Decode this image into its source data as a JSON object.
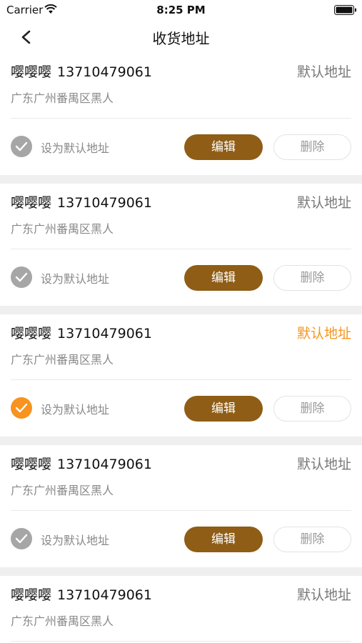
{
  "status_bar": {
    "carrier": "Carrier",
    "time": "8:25 PM"
  },
  "nav": {
    "title": "收货地址"
  },
  "addresses": [
    {
      "name": "嘤嘤嘤",
      "phone": "13710479061",
      "address": "广东广州番禺区黑人",
      "default_tag": "默认地址",
      "set_default_label": "设为默认地址",
      "edit_label": "编辑",
      "delete_label": "删除",
      "is_default": false
    },
    {
      "name": "嘤嘤嘤",
      "phone": "13710479061",
      "address": "广东广州番禺区黑人",
      "default_tag": "默认地址",
      "set_default_label": "设为默认地址",
      "edit_label": "编辑",
      "delete_label": "删除",
      "is_default": false
    },
    {
      "name": "嘤嘤嘤",
      "phone": "13710479061",
      "address": "广东广州番禺区黑人",
      "default_tag": "默认地址",
      "set_default_label": "设为默认地址",
      "edit_label": "编辑",
      "delete_label": "删除",
      "is_default": true
    },
    {
      "name": "嘤嘤嘤",
      "phone": "13710479061",
      "address": "广东广州番禺区黑人",
      "default_tag": "默认地址",
      "set_default_label": "设为默认地址",
      "edit_label": "编辑",
      "delete_label": "删除",
      "is_default": false
    },
    {
      "name": "嘤嘤嘤",
      "phone": "13710479061",
      "address": "广东广州番禺区黑人",
      "default_tag": "默认地址",
      "is_default": false
    }
  ],
  "colors": {
    "accent": "#f7931e",
    "edit_button": "#8f5d15",
    "unchecked": "#a6a6a6",
    "separator": "#efefef"
  },
  "icons": {
    "back": "chevron-left-icon",
    "check": "checkmark-icon",
    "wifi": "wifi-icon",
    "battery": "battery-icon"
  }
}
